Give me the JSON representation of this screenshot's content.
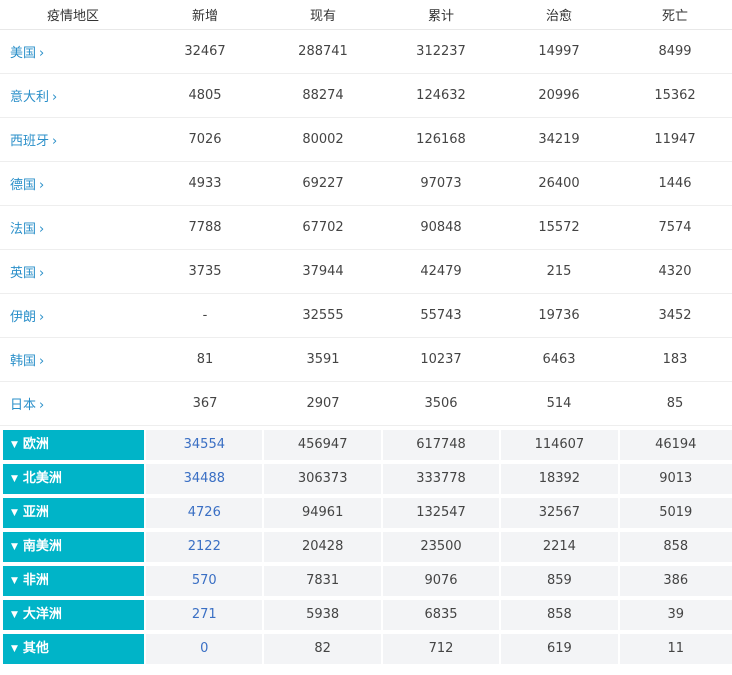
{
  "headers": [
    "疫情地区",
    "新增",
    "现有",
    "累计",
    "治愈",
    "死亡"
  ],
  "countries": [
    {
      "name": "美国",
      "new": "32467",
      "current": "288741",
      "total": "312237",
      "cured": "14997",
      "dead": "8499"
    },
    {
      "name": "意大利",
      "new": "4805",
      "current": "88274",
      "total": "124632",
      "cured": "20996",
      "dead": "15362"
    },
    {
      "name": "西班牙",
      "new": "7026",
      "current": "80002",
      "total": "126168",
      "cured": "34219",
      "dead": "11947"
    },
    {
      "name": "德国",
      "new": "4933",
      "current": "69227",
      "total": "97073",
      "cured": "26400",
      "dead": "1446"
    },
    {
      "name": "法国",
      "new": "7788",
      "current": "67702",
      "total": "90848",
      "cured": "15572",
      "dead": "7574"
    },
    {
      "name": "英国",
      "new": "3735",
      "current": "37944",
      "total": "42479",
      "cured": "215",
      "dead": "4320"
    },
    {
      "name": "伊朗",
      "new": "-",
      "current": "32555",
      "total": "55743",
      "cured": "19736",
      "dead": "3452"
    },
    {
      "name": "韩国",
      "new": "81",
      "current": "3591",
      "total": "10237",
      "cured": "6463",
      "dead": "183"
    },
    {
      "name": "日本",
      "new": "367",
      "current": "2907",
      "total": "3506",
      "cured": "514",
      "dead": "85"
    }
  ],
  "regions": [
    {
      "name": "欧洲",
      "new": "34554",
      "current": "456947",
      "total": "617748",
      "cured": "114607",
      "dead": "46194"
    },
    {
      "name": "北美洲",
      "new": "34488",
      "current": "306373",
      "total": "333778",
      "cured": "18392",
      "dead": "9013"
    },
    {
      "name": "亚洲",
      "new": "4726",
      "current": "94961",
      "total": "132547",
      "cured": "32567",
      "dead": "5019"
    },
    {
      "name": "南美洲",
      "new": "2122",
      "current": "20428",
      "total": "23500",
      "cured": "2214",
      "dead": "858"
    },
    {
      "name": "非洲",
      "new": "570",
      "current": "7831",
      "total": "9076",
      "cured": "859",
      "dead": "386"
    },
    {
      "name": "大洋洲",
      "new": "271",
      "current": "5938",
      "total": "6835",
      "cured": "858",
      "dead": "39"
    },
    {
      "name": "其他",
      "new": "0",
      "current": "82",
      "total": "712",
      "cured": "619",
      "dead": "11"
    }
  ],
  "icons": {
    "country_chevron": "chevron-right-icon",
    "region_toggle": "caret-down-icon"
  },
  "colors": {
    "region_bg": "#00b4c8",
    "link": "#2a8fc9",
    "new_value": "#3a6fc4"
  }
}
